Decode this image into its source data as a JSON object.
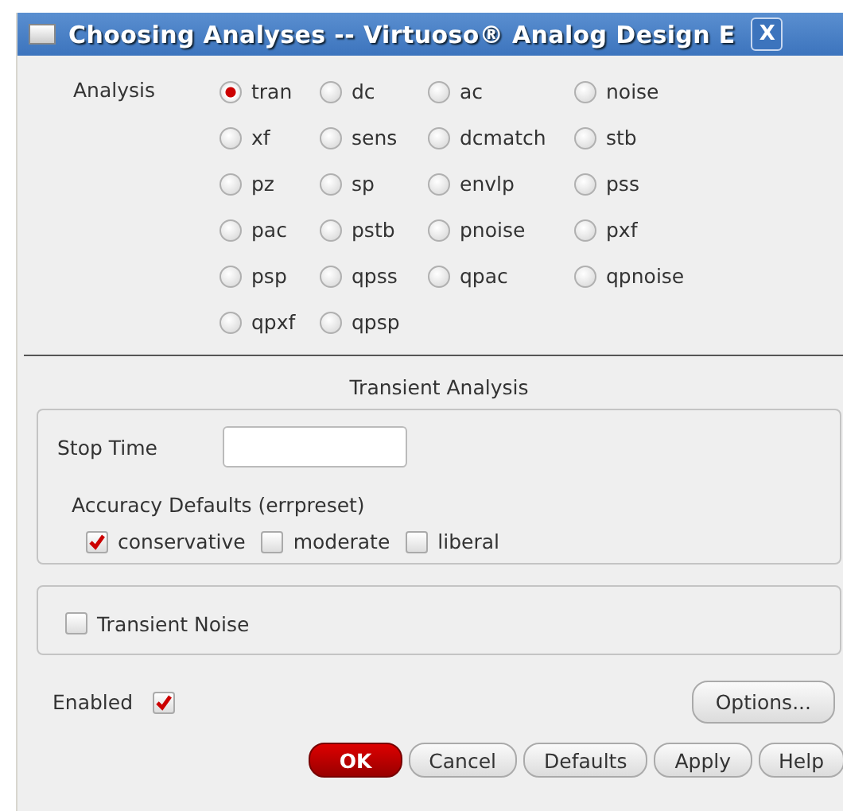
{
  "window": {
    "title": "Choosing Analyses -- Virtuoso® Analog Design E",
    "close": "X"
  },
  "analysis": {
    "label": "Analysis",
    "options": [
      {
        "label": "tran",
        "selected": true
      },
      {
        "label": "dc",
        "selected": false
      },
      {
        "label": "ac",
        "selected": false
      },
      {
        "label": "noise",
        "selected": false
      },
      {
        "label": "xf",
        "selected": false
      },
      {
        "label": "sens",
        "selected": false
      },
      {
        "label": "dcmatch",
        "selected": false
      },
      {
        "label": "stb",
        "selected": false
      },
      {
        "label": "pz",
        "selected": false
      },
      {
        "label": "sp",
        "selected": false
      },
      {
        "label": "envlp",
        "selected": false
      },
      {
        "label": "pss",
        "selected": false
      },
      {
        "label": "pac",
        "selected": false
      },
      {
        "label": "pstb",
        "selected": false
      },
      {
        "label": "pnoise",
        "selected": false
      },
      {
        "label": "pxf",
        "selected": false
      },
      {
        "label": "psp",
        "selected": false
      },
      {
        "label": "qpss",
        "selected": false
      },
      {
        "label": "qpac",
        "selected": false
      },
      {
        "label": "qpnoise",
        "selected": false
      },
      {
        "label": "qpxf",
        "selected": false
      },
      {
        "label": "qpsp",
        "selected": false
      }
    ]
  },
  "section_title": "Transient Analysis",
  "stop_time": {
    "label": "Stop Time"
  },
  "accuracy": {
    "label": "Accuracy Defaults (errpreset)",
    "options": [
      {
        "label": "conservative",
        "checked": true
      },
      {
        "label": "moderate",
        "checked": false
      },
      {
        "label": "liberal",
        "checked": false
      }
    ]
  },
  "transient_noise": {
    "label": "Transient Noise",
    "checked": false
  },
  "enabled": {
    "label": "Enabled",
    "checked": true
  },
  "options_button": "Options...",
  "buttons": [
    {
      "label": "OK",
      "default": true
    },
    {
      "label": "Cancel",
      "default": false
    },
    {
      "label": "Defaults",
      "default": false
    },
    {
      "label": "Apply",
      "default": false
    },
    {
      "label": "Help",
      "default": false
    }
  ]
}
